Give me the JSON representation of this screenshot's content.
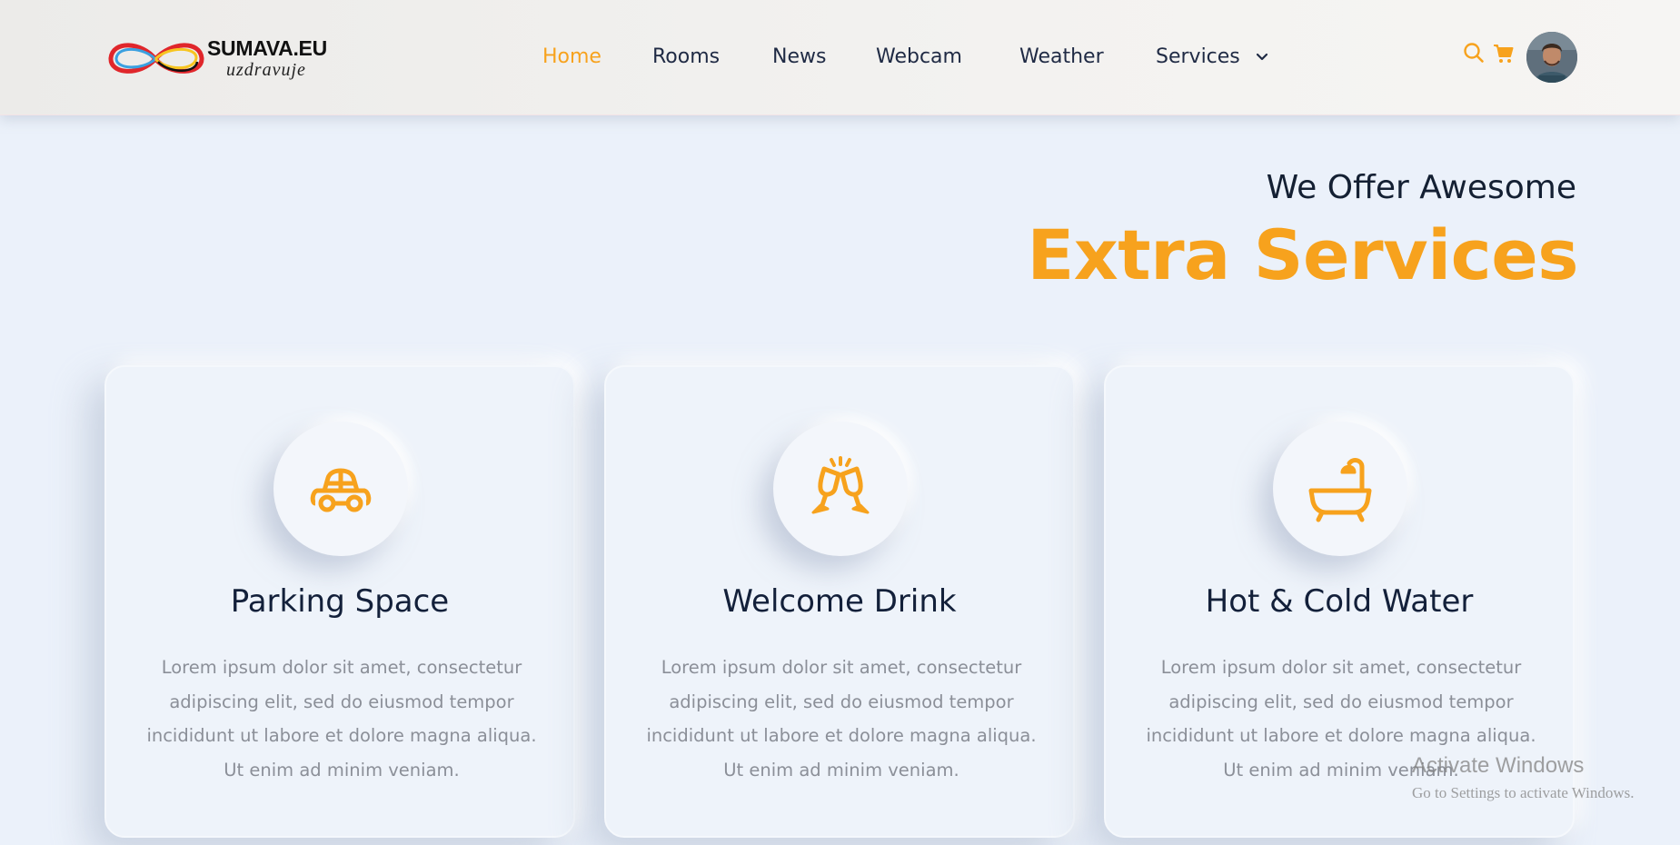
{
  "header": {
    "logo": {
      "title": "SUMAVA.EU",
      "subtitle": "uzdravuje",
      "colors": [
        "#e0262b",
        "#3aa0e0",
        "#f7c520",
        "#111111"
      ]
    },
    "nav": [
      {
        "label": "Home",
        "active": true
      },
      {
        "label": "Rooms",
        "active": false
      },
      {
        "label": "News",
        "active": false
      },
      {
        "label": "Webcam",
        "active": false
      },
      {
        "label": "Weather",
        "active": false
      },
      {
        "label": "Services",
        "active": false,
        "has_dropdown": true
      }
    ],
    "icons": [
      "search-icon",
      "cart-icon"
    ],
    "avatar": "user-avatar"
  },
  "hero": {
    "subheading": "We Offer Awesome",
    "heading": "Extra Services"
  },
  "cards": [
    {
      "icon": "car-icon",
      "title": "Parking Space",
      "text": "Lorem ipsum dolor sit amet, consectetur adipiscing elit, sed do eiusmod tempor incididunt ut labore et dolore magna aliqua. Ut enim ad minim veniam."
    },
    {
      "icon": "cheers-glasses-icon",
      "title": "Welcome Drink",
      "text": "Lorem ipsum dolor sit amet, consectetur adipiscing elit, sed do eiusmod tempor incididunt ut labore et dolore magna aliqua. Ut enim ad minim veniam."
    },
    {
      "icon": "bathtub-icon",
      "title": "Hot & Cold Water",
      "text": "Lorem ipsum dolor sit amet, consectetur adipiscing elit, sed do eiusmod tempor incididunt ut labore et dolore magna aliqua. Ut enim ad minim veniam."
    }
  ],
  "watermark": {
    "title": "Activate Windows",
    "subtitle": "Go to Settings to activate Windows."
  },
  "colors": {
    "accent": "#f7a21d",
    "heading_dark": "#142033",
    "body_text": "#8b8f98",
    "background": "#ebf1fa"
  }
}
